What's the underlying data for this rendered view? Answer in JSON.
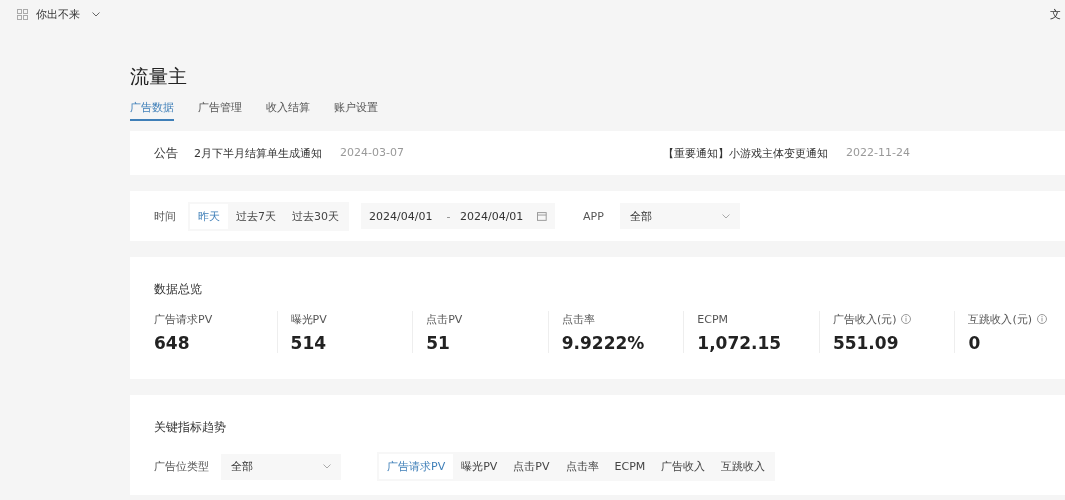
{
  "topbar": {
    "account": "你出不来",
    "right_link": "文"
  },
  "title": "流量主",
  "tabs": [
    {
      "label": "广告数据",
      "selected": true
    },
    {
      "label": "广告管理",
      "selected": false
    },
    {
      "label": "收入结算",
      "selected": false
    },
    {
      "label": "账户设置",
      "selected": false
    }
  ],
  "notices": {
    "label": "公告",
    "items": [
      {
        "text": "2月下半月结算单生成通知",
        "date": "2024-03-07"
      },
      {
        "text": "【重要通知】小游戏主体变更通知",
        "date": "2022-11-24"
      }
    ]
  },
  "filter": {
    "time_label": "时间",
    "ranges": [
      {
        "label": "昨天",
        "selected": true
      },
      {
        "label": "过去7天",
        "selected": false
      },
      {
        "label": "过去30天",
        "selected": false
      }
    ],
    "date_from": "2024/04/01",
    "date_separator": "-",
    "date_to": "2024/04/01",
    "app_label": "APP",
    "app_value": "全部"
  },
  "overview": {
    "title": "数据总览",
    "metrics": [
      {
        "label": "广告请求PV",
        "value": "648",
        "info": false
      },
      {
        "label": "曝光PV",
        "value": "514",
        "info": false
      },
      {
        "label": "点击PV",
        "value": "51",
        "info": false
      },
      {
        "label": "点击率",
        "value": "9.9222%",
        "info": false
      },
      {
        "label": "ECPM",
        "value": "1,072.15",
        "info": false
      },
      {
        "label": "广告收入(元)",
        "value": "551.09",
        "info": true
      },
      {
        "label": "互跳收入(元)",
        "value": "0",
        "info": true
      }
    ]
  },
  "trend": {
    "title": "关键指标趋势",
    "type_label": "广告位类型",
    "type_value": "全部",
    "metric_tabs": [
      {
        "label": "广告请求PV",
        "selected": true
      },
      {
        "label": "曝光PV",
        "selected": false
      },
      {
        "label": "点击PV",
        "selected": false
      },
      {
        "label": "点击率",
        "selected": false
      },
      {
        "label": "ECPM",
        "selected": false
      },
      {
        "label": "广告收入",
        "selected": false
      },
      {
        "label": "互跳收入",
        "selected": false
      }
    ]
  }
}
